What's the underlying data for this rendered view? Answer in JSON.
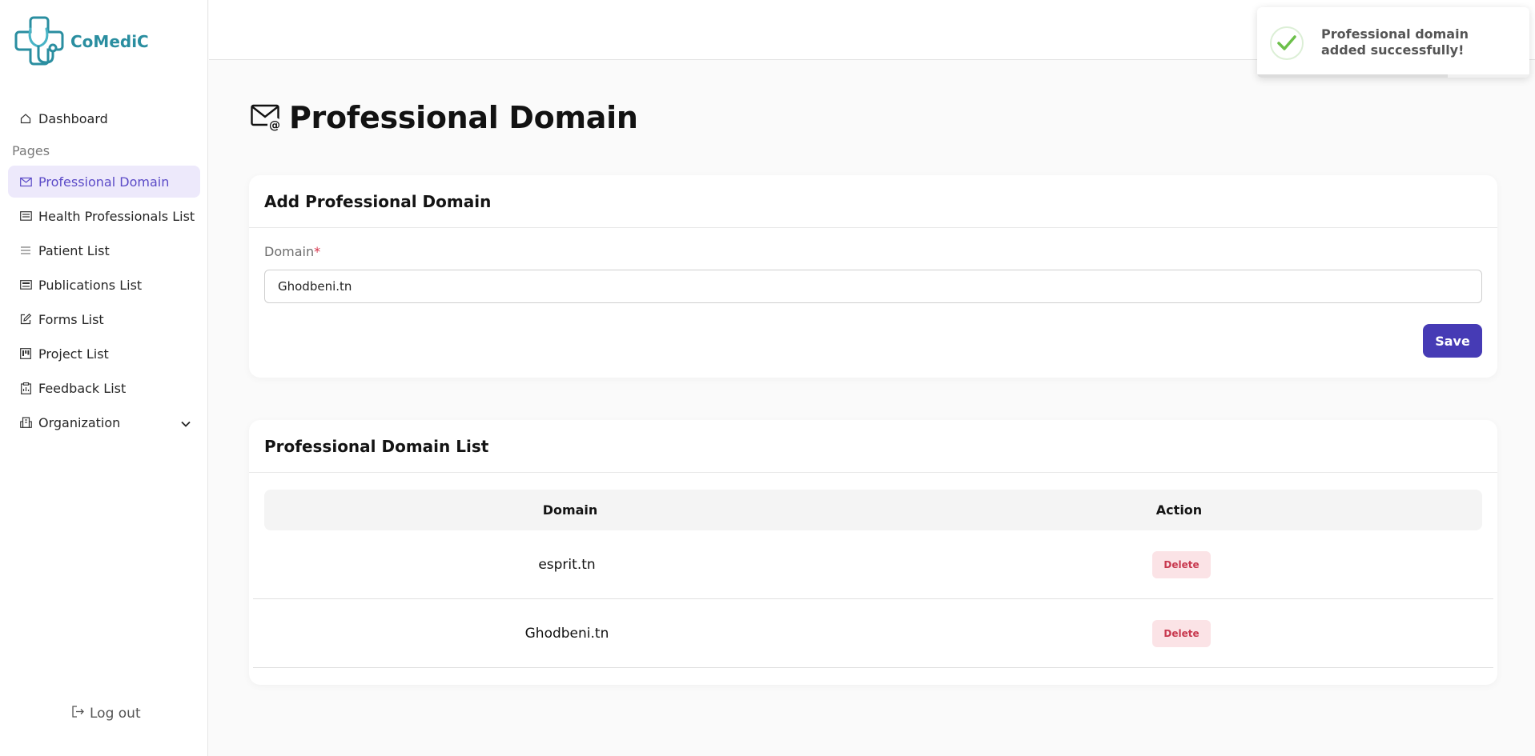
{
  "app": {
    "name": "CoMediC"
  },
  "sidebar": {
    "items": [
      {
        "label": "Dashboard",
        "icon": "home-icon",
        "active": false
      },
      {
        "section": "Pages"
      },
      {
        "label": "Professional Domain",
        "icon": "mail-at-icon",
        "active": true
      },
      {
        "label": "Health Professionals List",
        "icon": "list-card-icon",
        "active": false
      },
      {
        "label": "Patient List",
        "icon": "lines-icon",
        "active": false
      },
      {
        "label": "Publications List",
        "icon": "newspaper-icon",
        "active": false
      },
      {
        "label": "Forms List",
        "icon": "edit-icon",
        "active": false
      },
      {
        "label": "Project List",
        "icon": "kanban-icon",
        "active": false
      },
      {
        "label": "Feedback List",
        "icon": "clipboard-icon",
        "active": false
      },
      {
        "label": "Organization",
        "icon": "building-icon",
        "active": false,
        "expandable": true
      }
    ],
    "logout_label": "Log out"
  },
  "page": {
    "title": "Professional Domain"
  },
  "add_card": {
    "title": "Add Professional Domain",
    "field_label": "Domain",
    "required_mark": "*",
    "input_value": "Ghodbeni.tn",
    "save_label": "Save"
  },
  "list_card": {
    "title": "Professional Domain List",
    "columns": [
      "Domain",
      "Action"
    ],
    "rows": [
      {
        "domain": "esprit.tn",
        "action": "Delete"
      },
      {
        "domain": "Ghodbeni.tn",
        "action": "Delete"
      }
    ]
  },
  "toast": {
    "message": "Professional domain added successfully!",
    "progress": 0.7
  },
  "colors": {
    "brand": "#2a8ea0",
    "accent": "#463bb5",
    "active_bg": "#ede9fb",
    "danger": "#c8394f",
    "success": "#6cc04a"
  }
}
